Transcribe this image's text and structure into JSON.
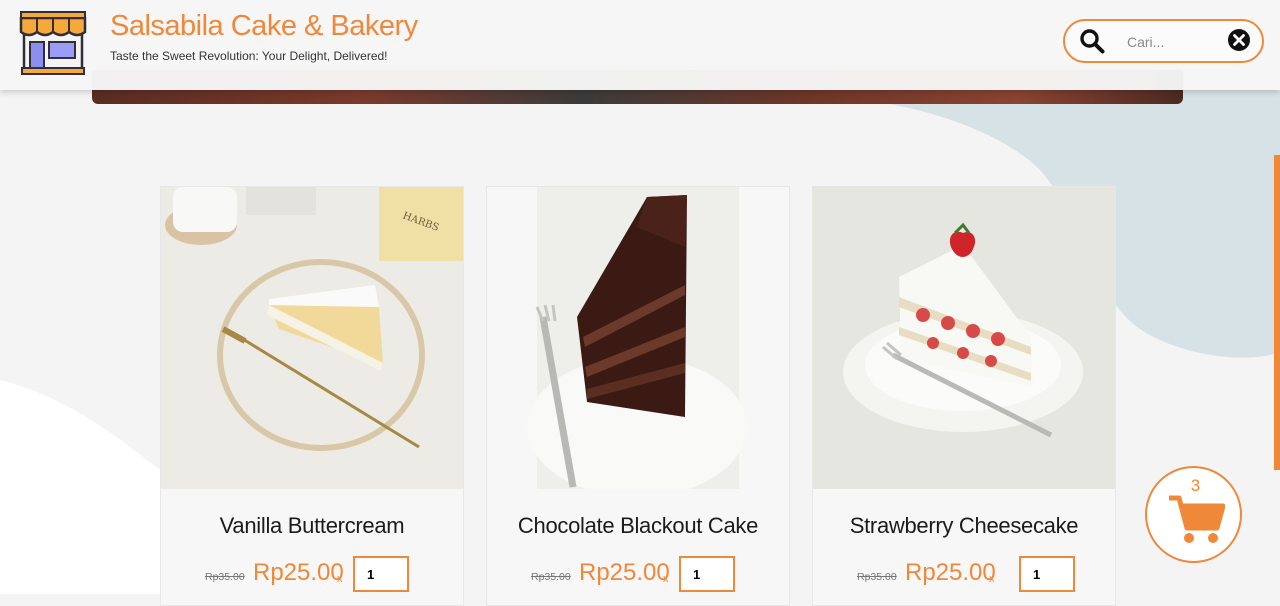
{
  "header": {
    "logo_icon": "storefront-icon",
    "title": "Salsabila Cake & Bakery",
    "tagline": "Taste the Sweet Revolution: Your Delight, Delivered!"
  },
  "search": {
    "placeholder": "Cari...",
    "value": "",
    "search_icon": "search-icon",
    "clear_icon": "close-circle-icon"
  },
  "products": [
    {
      "name": "Vanilla Buttercream",
      "old_price": "Rp35.00",
      "price": "Rp25.00",
      "times": "x",
      "quantity": "1"
    },
    {
      "name": "Chocolate Blackout Cake",
      "old_price": "Rp35.00",
      "price": "Rp25.00",
      "times": "x",
      "quantity": "1"
    },
    {
      "name": "Strawberry Cheesecake",
      "old_price": "Rp35.00",
      "price": "Rp25.00",
      "times": "x",
      "quantity": "1"
    }
  ],
  "cart": {
    "count": "3",
    "icon": "cart-icon"
  },
  "colors": {
    "accent": "#f0883a",
    "background": "#f3f4f3",
    "blob": "#d6e2e6"
  }
}
